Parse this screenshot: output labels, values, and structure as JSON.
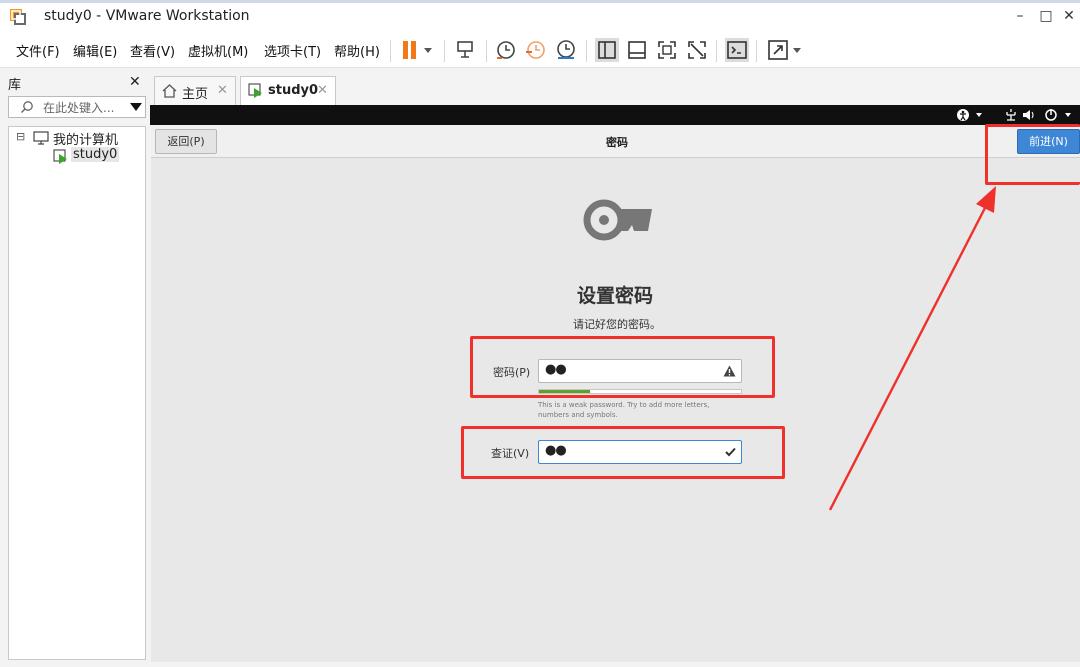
{
  "window": {
    "title": "study0 - VMware Workstation",
    "minimize": "–",
    "maximize": "□",
    "close": "✕"
  },
  "menu": [
    "文件(F)",
    "编辑(E)",
    "查看(V)",
    "虚拟机(M)",
    "选项卡(T)",
    "帮助(H)"
  ],
  "library": {
    "title": "库",
    "close": "✕",
    "search_placeholder": "在此处键入...",
    "root": "我的计算机",
    "vm": "study0"
  },
  "tabs": [
    {
      "label": "主页",
      "close": "✕"
    },
    {
      "label": "study0",
      "close": "✕"
    }
  ],
  "vm": {
    "back_label": "返回(P)",
    "header_title": "密码",
    "next_label": "前进(N)",
    "heading": "设置密码",
    "subheading": "请记好您的密码。",
    "password_label": "密码(P)",
    "password_value": "●●",
    "hint": "This is a weak password. Try to add more letters, numbers and symbols.",
    "confirm_label": "查证(V)",
    "confirm_value": "●●",
    "accent": "#3d87d6"
  },
  "colors": {
    "annotation": "#f0302a",
    "pause": "#f07a1a",
    "strength": "#5aa22c"
  }
}
